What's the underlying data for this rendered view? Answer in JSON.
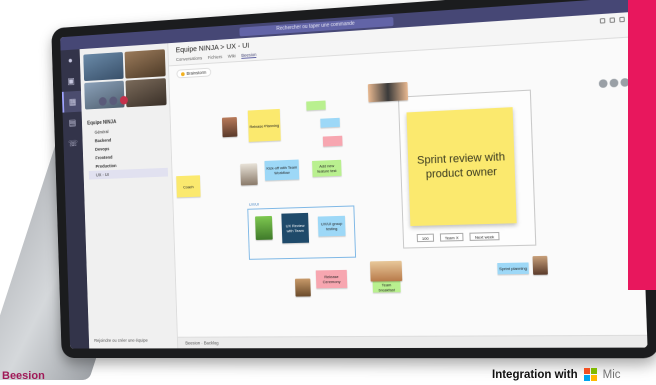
{
  "teams": {
    "search_placeholder": "Rechercher ou taper une commande",
    "title": "Equipe NINJA > UX - UI",
    "tabs": [
      "Conversations",
      "Fichiers",
      "Wiki",
      "Beesion"
    ],
    "team_name": "Equipe NINJA",
    "channels": [
      "Général",
      "Backend",
      "Devops",
      "Frontend",
      "Production",
      "UX - UI"
    ],
    "join_team": "Rejoindre ou créer une équipe",
    "status_text": "Beesion · Backlog"
  },
  "board": {
    "tag": "Brainstorm",
    "notes": {
      "release_planning": "Release Planning",
      "kickoff": "Kick-off with Team Workflow",
      "new_version": "Add new feature test",
      "ux_lab": "UX/UI group testing",
      "ux_review": "UX Review with Team",
      "coach": "Coach",
      "release_ceremony": "Release Ceremony",
      "team_breakfast": "Team breakfast",
      "sprint_planning": "Sprint planning",
      "sprint_review": "Sprint review with product owner"
    },
    "group_label": "UX/UI",
    "chips": [
      "100",
      "Team X",
      "Next week"
    ]
  },
  "footer": {
    "brand_left": "Beesion",
    "integration": "Integration with",
    "ms_text": "Mic"
  },
  "colors": {
    "accent_strip": "#e8175d",
    "teams_purple": "#464775",
    "sticky_yellow": "#fbe96e"
  }
}
